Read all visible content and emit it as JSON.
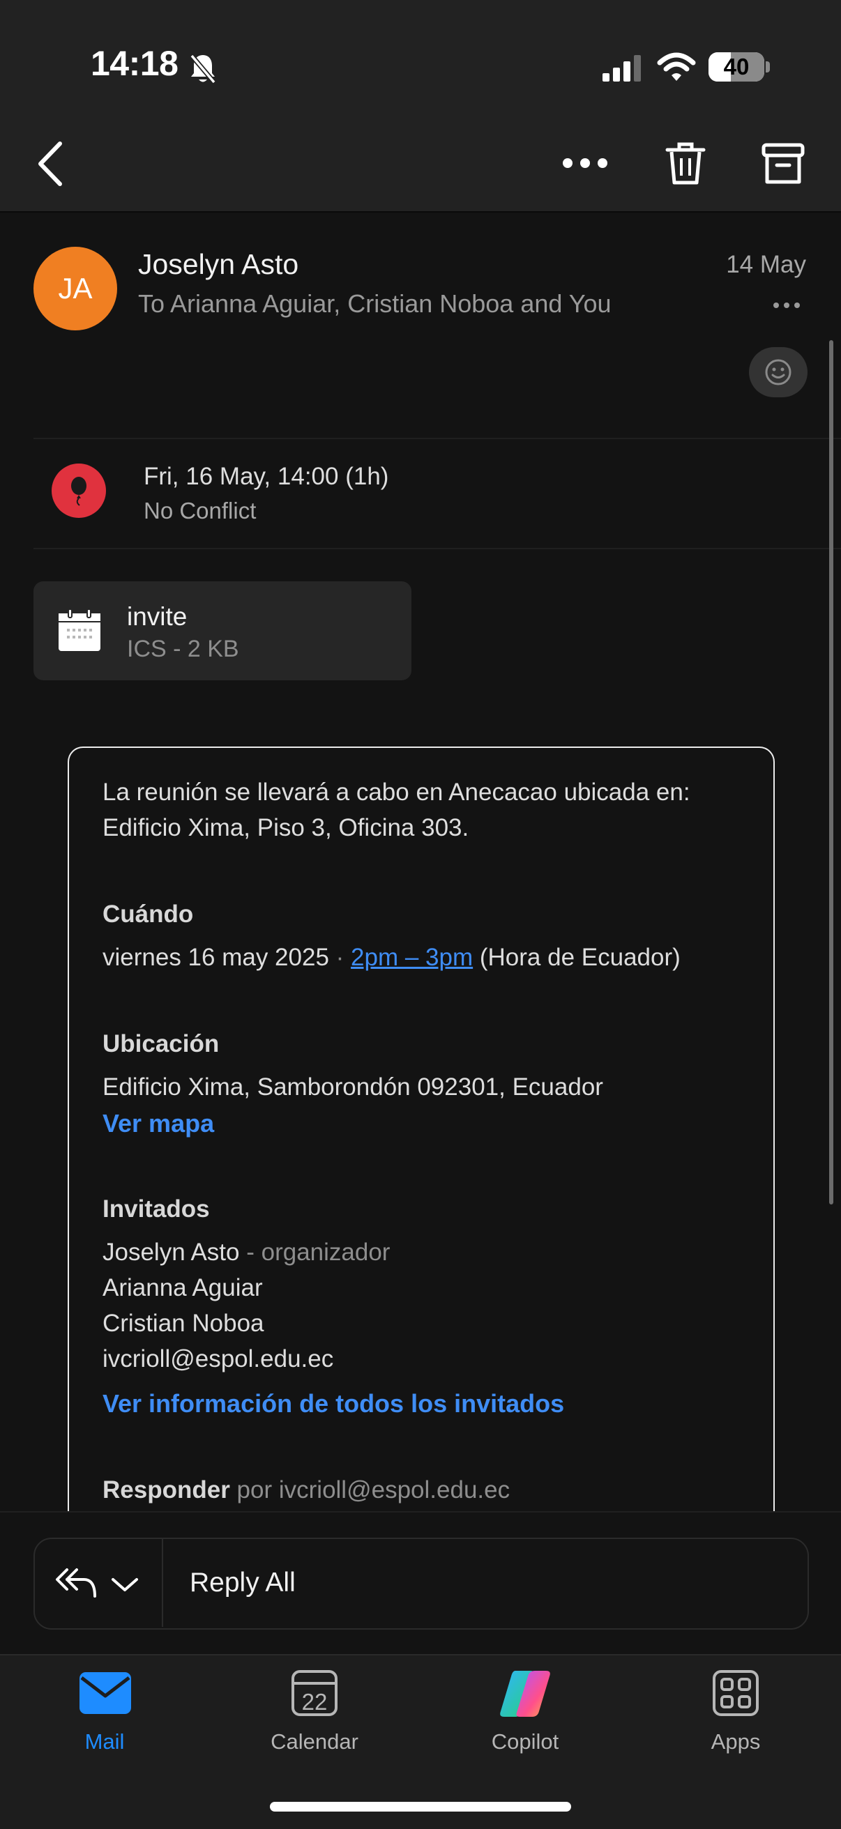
{
  "status_bar": {
    "time": "14:18",
    "battery": "40",
    "battery_level": 0.4
  },
  "toolbar": {
    "back": "back",
    "more": "more",
    "delete": "delete",
    "archive": "archive"
  },
  "message": {
    "avatar_initials": "JA",
    "sender": "Joselyn Asto",
    "recipients": "To Arianna Aguiar, Cristian Noboa and You",
    "date": "14 May"
  },
  "event": {
    "datetime": "Fri, 16 May, 14:00 (1h)",
    "conflict": "No Conflict"
  },
  "attachment": {
    "name": "invite",
    "meta": "ICS - 2 KB"
  },
  "invite": {
    "intro_line1": "La reunión se llevará a cabo en Anecacao ubicada en:",
    "intro_line2": "Edificio Xima, Piso 3, Oficina 303.",
    "when_heading": "Cuándo",
    "when_date": "viernes 16 may 2025",
    "when_sep": "·",
    "when_time": "2pm – 3pm",
    "when_tz": "(Hora de Ecuador)",
    "location_heading": "Ubicación",
    "location_address": "Edificio Xima, Samborondón 092301, Ecuador",
    "map_link": "Ver mapa",
    "guests_heading": "Invitados",
    "guests": [
      {
        "name": "Joselyn Asto",
        "role": "- organizador"
      },
      {
        "name": "Arianna Aguiar"
      },
      {
        "name": "Cristian Noboa"
      },
      {
        "name": "ivcrioll@espol.edu.ec"
      }
    ],
    "all_guests_link": "Ver información de todos los invitados",
    "respond_heading": "Responder",
    "respond_by": "por ivcrioll@espol.edu.ec"
  },
  "reply": {
    "label": "Reply All"
  },
  "tabs": [
    {
      "label": "Mail",
      "active": true
    },
    {
      "label": "Calendar",
      "icon_day": "22"
    },
    {
      "label": "Copilot"
    },
    {
      "label": "Apps"
    }
  ],
  "colors": {
    "accent": "#1e8cff",
    "avatar": "#f07f22",
    "event_icon": "#e0323e",
    "link": "#3f8df5"
  }
}
